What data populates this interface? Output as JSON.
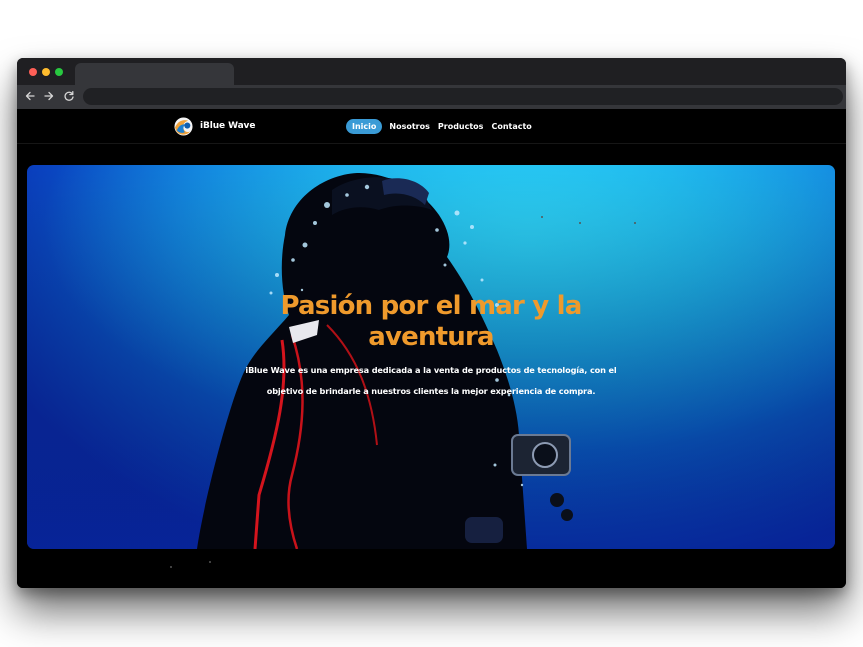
{
  "browser": {
    "controls": [
      "close",
      "minimize",
      "maximize"
    ],
    "nav_icons": [
      "back-arrow-icon",
      "forward-arrow-icon",
      "reload-icon"
    ]
  },
  "site": {
    "brand": {
      "name": "iBlue Wave",
      "logo_icon": "wave-globe-logo"
    },
    "menu": [
      {
        "label": "Inicio",
        "active": true
      },
      {
        "label": "Nosotros",
        "active": false
      },
      {
        "label": "Productos",
        "active": false
      },
      {
        "label": "Contacto",
        "active": false
      }
    ],
    "colors": {
      "accent": "#3a9bd6",
      "title": "#ef9a2c",
      "background": "#000000"
    }
  },
  "hero": {
    "title": "Pasión por el mar y la aventura",
    "text": "iBlue Wave es una empresa dedicada a la venta de productos de tecnología, con el objetivo de brindarle a nuestros clientes la mejor experiencia de compra."
  }
}
